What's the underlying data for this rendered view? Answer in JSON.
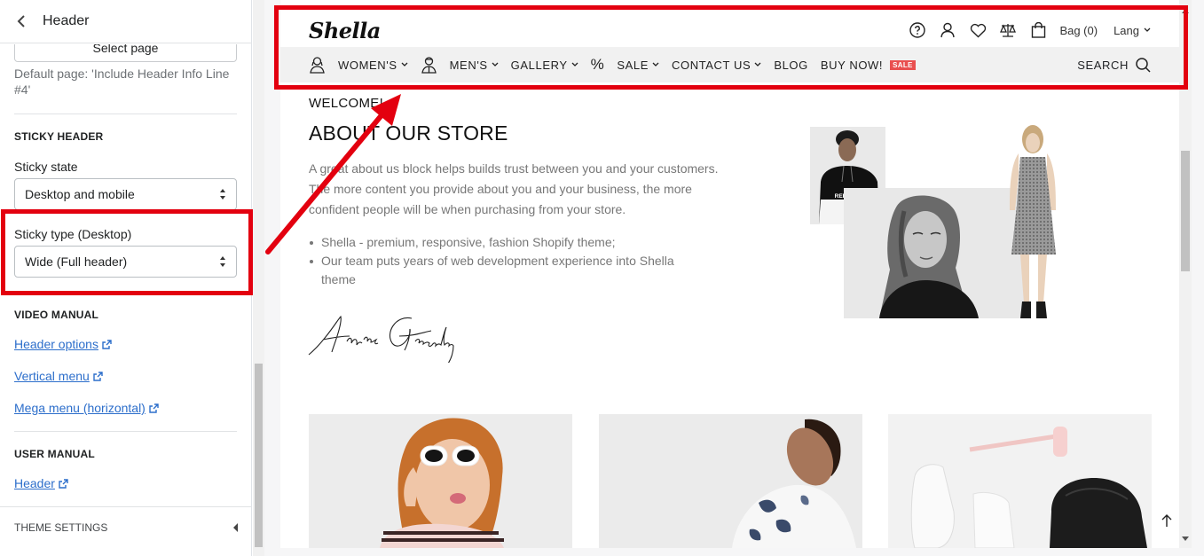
{
  "panel": {
    "title": "Header",
    "select_page_label": "Select page",
    "default_page_info": "Default page: 'Include Header Info Line #4'",
    "sticky_header_heading": "STICKY HEADER",
    "sticky_state_label": "Sticky state",
    "sticky_state_value": "Desktop and mobile",
    "sticky_type_label": "Sticky type (Desktop)",
    "sticky_type_value": "Wide (Full header)",
    "video_manual_heading": "VIDEO MANUAL",
    "video_links": [
      "Header options",
      "Vertical menu",
      "Mega menu (horizontal)"
    ],
    "user_manual_heading": "USER MANUAL",
    "user_links": [
      "Header"
    ],
    "theme_settings_label": "THEME SETTINGS"
  },
  "store": {
    "logo": "Shella",
    "bag_label": "Bag (0)",
    "lang_label": "Lang",
    "nav": {
      "women": "WOMEN'S",
      "men": "MEN'S",
      "gallery": "GALLERY",
      "percent": "%",
      "sale": "SALE",
      "contact": "CONTACT US",
      "blog": "BLOG",
      "buy_now": "BUY NOW!",
      "sale_badge": "SALE",
      "search": "SEARCH"
    },
    "welcome": "WELCOME!",
    "about_title": "ABOUT OUR STORE",
    "about_text": "A great about us block helps builds trust between you and your customers. The more content you provide about you and your business, the more confident people will be when purchasing from your store.",
    "bullets": [
      "Shella - premium, responsive, fashion Shopify theme;",
      "Our team puts years of web development experience into Shella theme"
    ],
    "signature": "Annie Greenberg",
    "hoodie_text": "RELEASE"
  },
  "colors": {
    "highlight": "#e3000f",
    "link": "#2c6ecb",
    "sale_badge": "#e94f4f"
  }
}
